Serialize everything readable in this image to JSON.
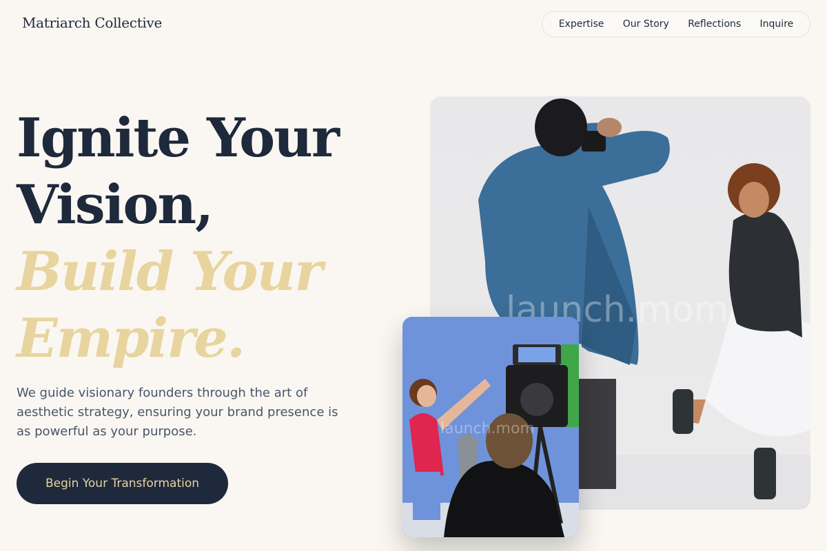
{
  "brand": {
    "name": "Matriarch Collective"
  },
  "nav": {
    "items": [
      "Expertise",
      "Our Story",
      "Reflections",
      "Inquire"
    ]
  },
  "hero": {
    "line1": "Ignite Your",
    "line2": "Vision,",
    "line3": "Build Your",
    "line4": "Empire.",
    "subtitle": "We guide visionary founders through the art of aesthetic strategy, ensuring your brand presence is as powerful as your purpose.",
    "cta": "Begin Your Transformation"
  },
  "images": {
    "main_watermark": "launch.mom",
    "small_watermark": "launch.mom"
  },
  "colors": {
    "background": "#faf7f2",
    "navy": "#1e293b",
    "gold": "#e8d49e",
    "body_text": "#475569"
  }
}
